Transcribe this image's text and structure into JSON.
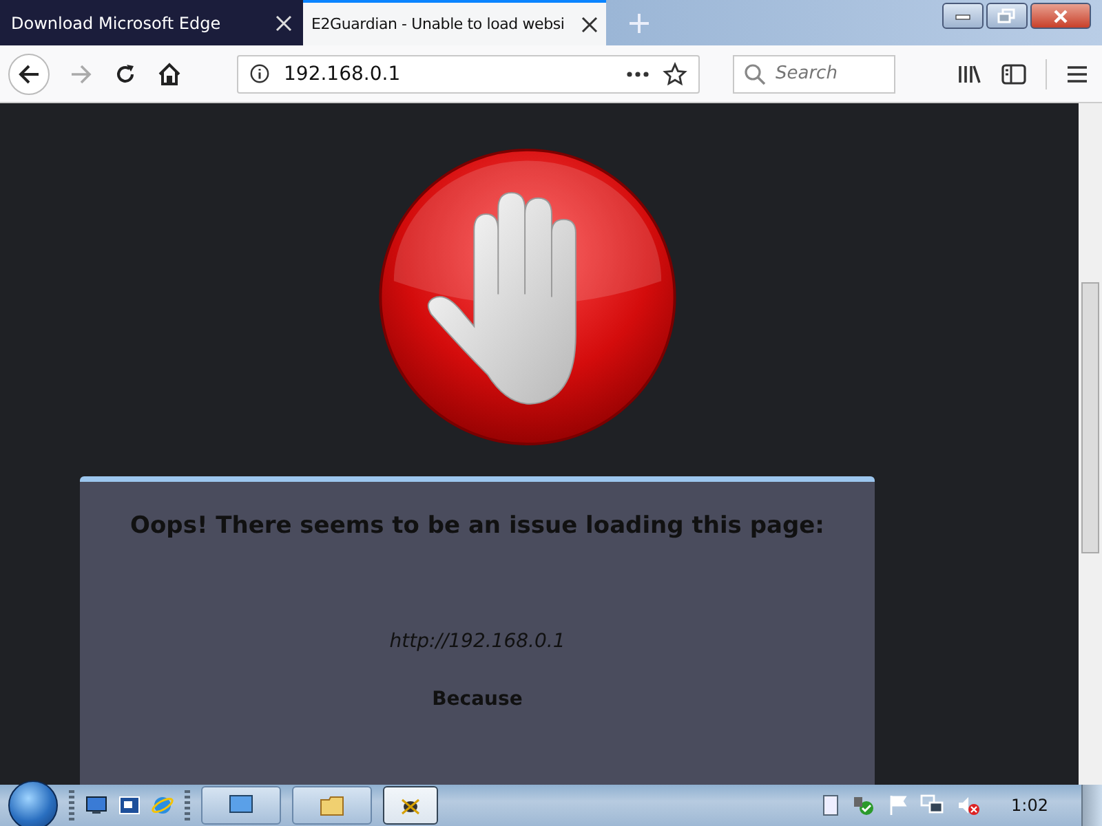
{
  "tabs": [
    {
      "title": "Download Microsoft Edge",
      "selected": false
    },
    {
      "title": "E2Guardian - Unable to load websi",
      "selected": true
    }
  ],
  "address_bar": {
    "value": "192.168.0.1"
  },
  "search": {
    "placeholder": "Search"
  },
  "error_card": {
    "heading": "Oops! There seems to be an issue loading this page:",
    "url": "http://192.168.0.1",
    "because": "Because"
  },
  "taskbar": {
    "buttons": [
      {
        "selected": false
      },
      {
        "selected": false
      },
      {
        "selected": true
      }
    ],
    "clock": "1:02"
  }
}
